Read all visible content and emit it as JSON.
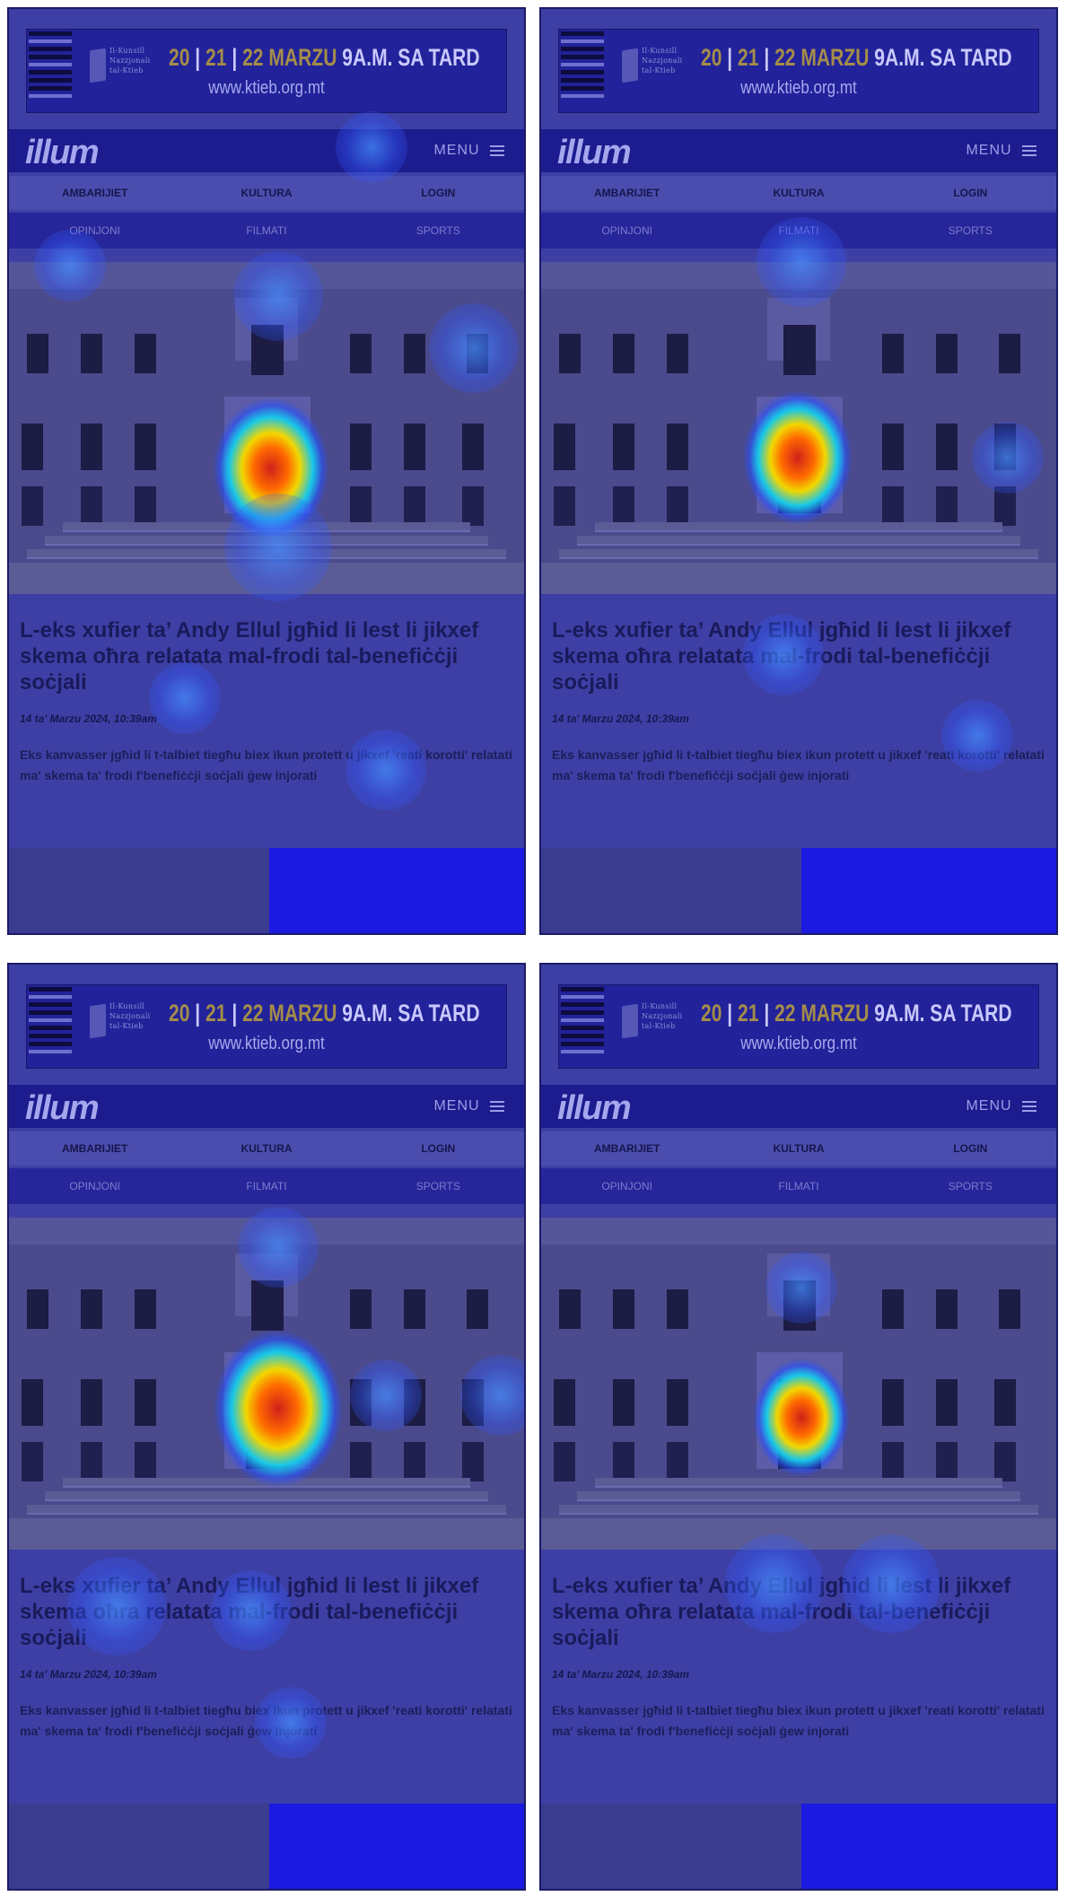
{
  "banner": {
    "organization": "Il-Kunsill Nazzjonali tal-Ktieb",
    "dates": [
      "20",
      "21",
      "22"
    ],
    "month": "MARZU",
    "time": "9A.M. SA TARD",
    "url": "www.ktieb.org.mt"
  },
  "header": {
    "logo": "illum",
    "menu_label": "MENU"
  },
  "nav": {
    "row1": [
      "AMBARIJIET",
      "KULTURA",
      "LOGIN"
    ],
    "row2": [
      "OPINJONI",
      "FILMATI",
      "SPORTS"
    ]
  },
  "article": {
    "headline": "L-eks xufier ta’ Andy Ellul jgħid li lest li jikxef skema oħra relatata mal-frodi tal-benefiċċji soċjali",
    "date": "14 ta' Marzu 2024, 10:39am",
    "lead": "Eks kanvasser jgħid li t-talbiet tiegħu biex ikun protett u jikxef 'reati korotti' relatati ma' skema ta' frodi f'benefiċċji soċjali ġew injorati"
  },
  "colors": {
    "overlay": "#3d3fa4",
    "topbar": "#1c1c8f",
    "heat_hot": "#d0201a",
    "heat_warm": "#f2d700",
    "heat_cool": "#17c7e8"
  },
  "panels": [
    {
      "id": "top-left"
    },
    {
      "id": "top-right"
    },
    {
      "id": "bottom-left"
    },
    {
      "id": "bottom-right"
    }
  ]
}
